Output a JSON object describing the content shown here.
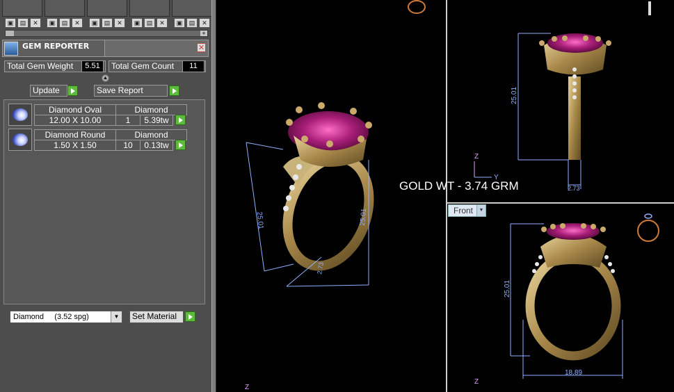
{
  "panel": {
    "title": "GEM REPORTER",
    "total_weight_label": "Total Gem Weight",
    "total_weight_value": "5.51",
    "total_count_label": "Total Gem Count",
    "total_count_value": "11",
    "update_label": "Update",
    "save_report_label": "Save Report",
    "gems": [
      {
        "name": "Diamond Oval",
        "material": "Diamond",
        "size": "12.00 X 10.00",
        "count": "1",
        "weight": "5.39tw"
      },
      {
        "name": "Diamond Round",
        "material": "Diamond",
        "size": "1.50 X 1.50",
        "count": "10",
        "weight": "0.13tw"
      }
    ],
    "material_selected": "Diamond     (3.52 spg)",
    "set_material_label": "Set Material"
  },
  "viewports": {
    "gold_wt_label": "GOLD WT - 3.74 GRM",
    "front_view_label": "Front",
    "dim_height_persp": "25.01",
    "dim_height_persp2": "25.01",
    "dim_small_persp": "2.73",
    "dim_height_side": "25.01",
    "dim_shank_side": "2.73",
    "dim_height_front": "25.01",
    "dim_width_front": "18.89",
    "axis_z": "Z",
    "axis_y": "Y"
  },
  "colors": {
    "gold": "#b59a5a",
    "ruby": "#9b1f6e",
    "dim_line": "#8fb0ff",
    "panel_bg": "#4d4d4d",
    "accent_green": "#5dbb3c"
  }
}
